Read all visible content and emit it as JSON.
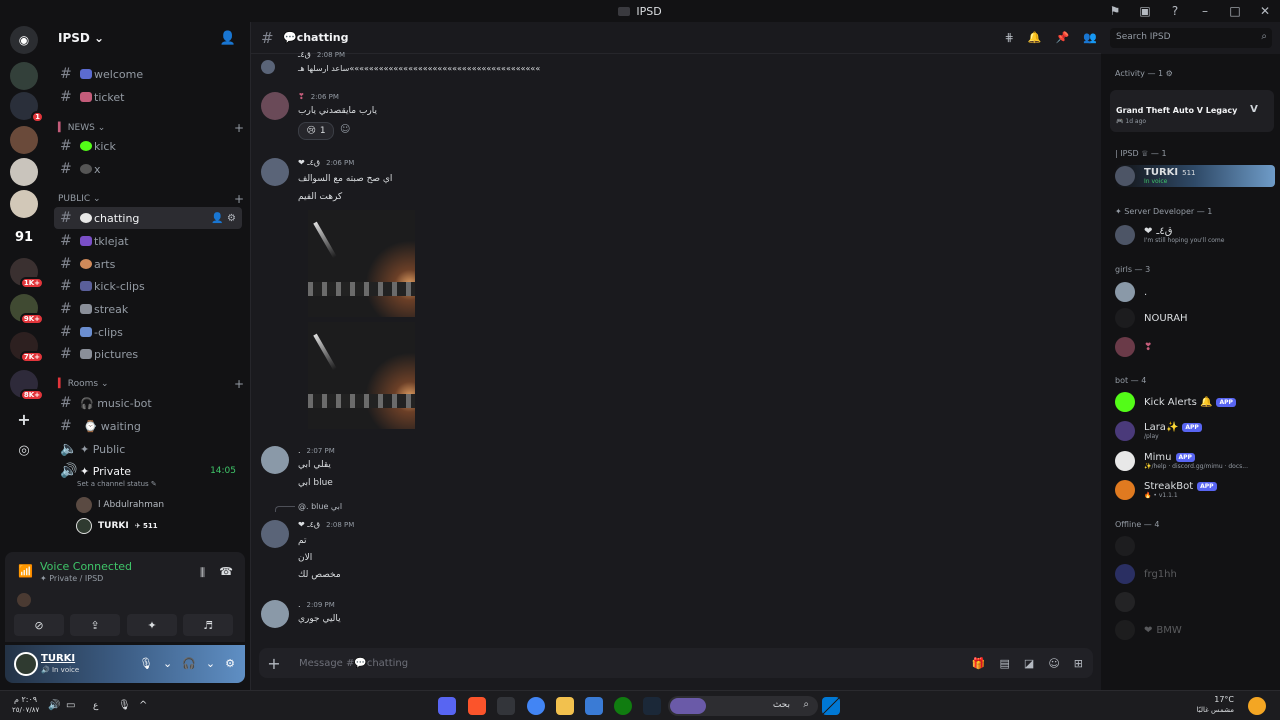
{
  "window": {
    "title": "IPSD"
  },
  "colors": {
    "accent": "#5865f2",
    "online": "#3fc569",
    "danger": "#e2353b"
  },
  "guild_badges": [
    "1",
    "1K+",
    "9K+",
    "7K+",
    "8K+"
  ],
  "guild_labels": {
    "ninety_one": "91"
  },
  "sidebar": {
    "server_name": "IPSD",
    "channels_top": [
      {
        "name": "welcome"
      },
      {
        "name": "ticket"
      }
    ],
    "category_news": "NEWS",
    "channels_news": [
      {
        "name": "kick"
      },
      {
        "name": "x"
      }
    ],
    "category_public": "PUBLIC",
    "channels_public": [
      {
        "name": "chatting"
      },
      {
        "name": "tklejat"
      },
      {
        "name": "arts"
      },
      {
        "name": "kick-clips"
      },
      {
        "name": "streak"
      },
      {
        "name": "-clips"
      },
      {
        "name": "pictures"
      }
    ],
    "category_rooms": "Rooms",
    "rooms": [
      {
        "name": "music-bot"
      },
      {
        "name": "waiting"
      },
      {
        "name": "✦ Public"
      }
    ],
    "private_room": {
      "name": "✦ Private",
      "timer": "14:05",
      "status": "Set a channel status"
    },
    "voice_users": [
      {
        "name": "l Abdulrahman"
      },
      {
        "name": "TURKI",
        "tag": "511"
      }
    ]
  },
  "voice": {
    "title": "Voice Connected",
    "sub": "✦ Private / IPSD"
  },
  "user_panel": {
    "name": "TURKI",
    "status": "In voice"
  },
  "channel": {
    "name": "chatting",
    "composer_placeholder": "Message #💬chatting"
  },
  "search": {
    "placeholder": "Search IPSD"
  },
  "messages": [
    {
      "time": "2:08 PM",
      "nick": "ق٤ـ",
      "lines": [
        "ﺳﺎﻋﺪ ﺍﺭﺳﻠﻬﺎ ﻫـ«««««««««««««««««««««««««««««««««««««««"
      ]
    },
    {
      "time": "2:06 PM",
      "nick": "",
      "lines": [
        "يارب مايقصدني يارب"
      ],
      "reaction_count": "1"
    },
    {
      "time": "2:06 PM",
      "nick": "ق٤ـ",
      "lines": [
        "اي صح صبته مع السوالف",
        "كرهت الفيم"
      ]
    },
    {
      "time": "2:07 PM",
      "nick": ".",
      "lines": [
        "يقلي ابي",
        "ابي blue"
      ]
    },
    {
      "time": "2:08 PM",
      "nick": "ق٤ـ",
      "reply": "@. blue ابي",
      "lines": [
        "تم",
        "الان",
        "مخصص لك"
      ]
    },
    {
      "time": "2:09 PM",
      "nick": ".",
      "lines": [
        "ياليي جوري"
      ]
    }
  ],
  "members": {
    "activity": {
      "header": "Activity — 1",
      "game": "Grand Theft Auto V Legacy",
      "ago": "1d ago"
    },
    "groups": [
      {
        "header": "| IPSD ♕ — 1",
        "items": [
          {
            "name": "TURKI",
            "tag": "511",
            "sub": "In voice"
          }
        ]
      },
      {
        "header": "✦ Server Developer — 1",
        "items": [
          {
            "name": "ق٤ـ",
            "sub": "I'm still hoping you'll come"
          }
        ]
      },
      {
        "header": "girls — 3",
        "items": [
          {
            "name": "."
          },
          {
            "name": "NOURAH"
          },
          {
            "name": "❣"
          }
        ]
      },
      {
        "header": "bot — 4",
        "items": [
          {
            "name": "Kick Alerts 🔔",
            "app": "APP",
            "sub": ""
          },
          {
            "name": "Lara✨",
            "app": "APP",
            "sub": "/play"
          },
          {
            "name": "Mimu",
            "app": "APP",
            "sub": "✨/help · discord.gg/mimu · docs..."
          },
          {
            "name": "StreakBot",
            "app": "APP",
            "sub": "🔥 • v1.1.1"
          }
        ]
      },
      {
        "header": "Offline — 4",
        "items": [
          {
            "name": ""
          },
          {
            "name": "frg1hh"
          },
          {
            "name": ""
          },
          {
            "name": "BMW"
          }
        ]
      }
    ]
  },
  "taskbar": {
    "time": "٢:٠٩ م",
    "date": "٢٥/٠٧/٨٧",
    "lang": "ع",
    "temp": "17°C",
    "weather": "مشمس غالبًا",
    "search": "بحث"
  }
}
